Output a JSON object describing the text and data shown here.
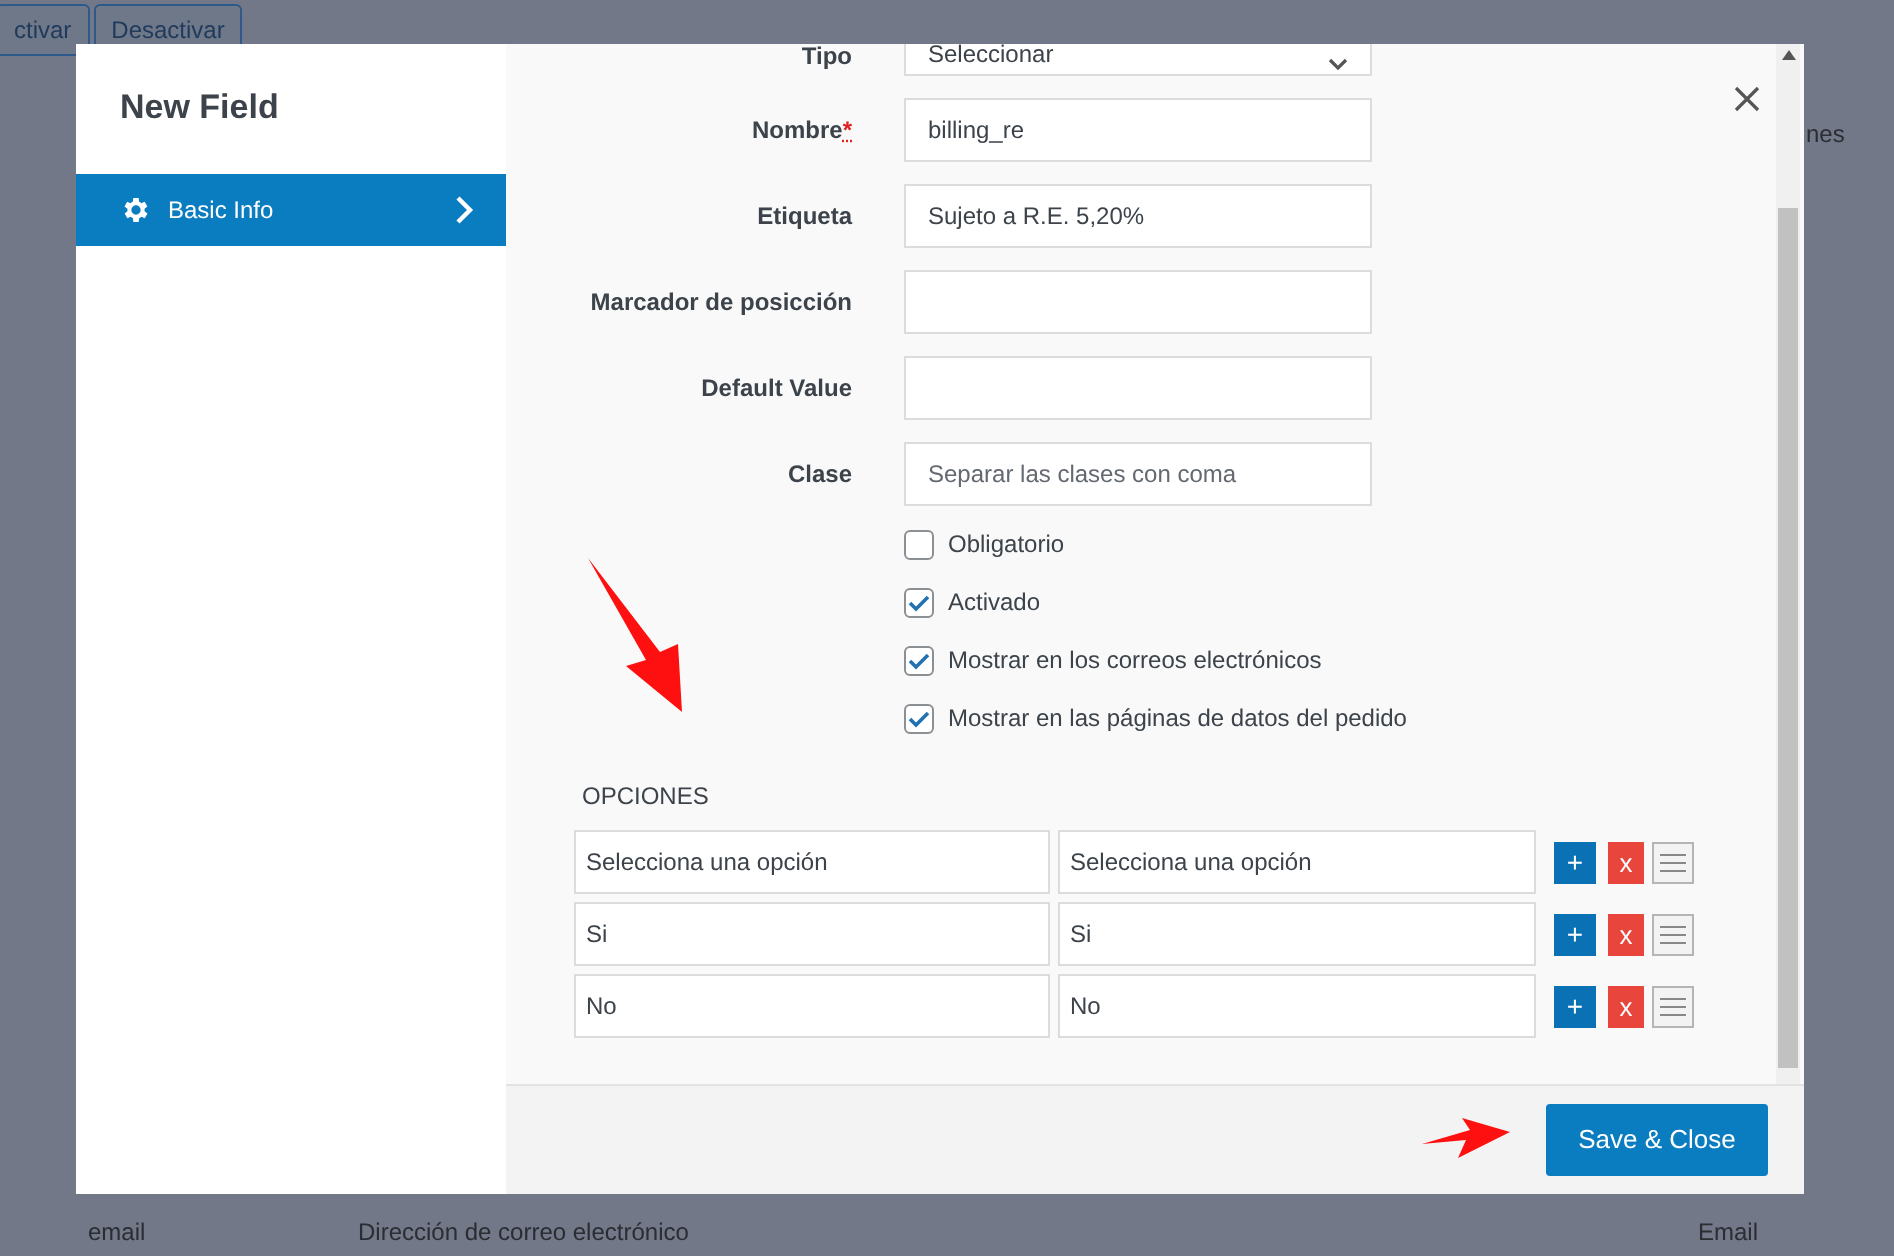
{
  "background": {
    "buttons": [
      "ctivar",
      "Desactivar"
    ],
    "header_fragment": "nes",
    "row": [
      "email",
      "Dirección de correo electrónico",
      "Email"
    ]
  },
  "dialog": {
    "title": "New Field",
    "sidebar": {
      "items": [
        {
          "label": "Basic Info",
          "selected": true
        }
      ]
    },
    "fields": [
      {
        "kind": "select",
        "label": "Tipo",
        "value": "Seleccionar"
      },
      {
        "kind": "text",
        "label": "Nombre",
        "required_mark": "*",
        "value": "billing_re"
      },
      {
        "kind": "text",
        "label": "Etiqueta",
        "value": "Sujeto a R.E. 5,20%"
      },
      {
        "kind": "text",
        "label": "Marcador de posicción"
      },
      {
        "kind": "text",
        "label": "Default Value"
      },
      {
        "kind": "text",
        "label": "Clase",
        "placeholder": "Separar las clases con coma"
      }
    ],
    "checkboxes": [
      {
        "label": "Obligatorio",
        "checked": false
      },
      {
        "label": "Activado",
        "checked": true
      },
      {
        "label": "Mostrar en los correos electrónicos",
        "checked": true
      },
      {
        "label": "Mostrar en las páginas de datos del pedido",
        "checked": true
      }
    ],
    "options": {
      "title": "OPCIONES",
      "rows": [
        {
          "value": "Selecciona una opción",
          "label": "Selecciona una opción",
          "add": "+",
          "remove": "x"
        },
        {
          "value": "Si",
          "label": "Si",
          "add": "+",
          "remove": "x"
        },
        {
          "value": "No",
          "label": "No",
          "add": "+",
          "remove": "x"
        }
      ]
    },
    "save_button": "Save & Close"
  }
}
